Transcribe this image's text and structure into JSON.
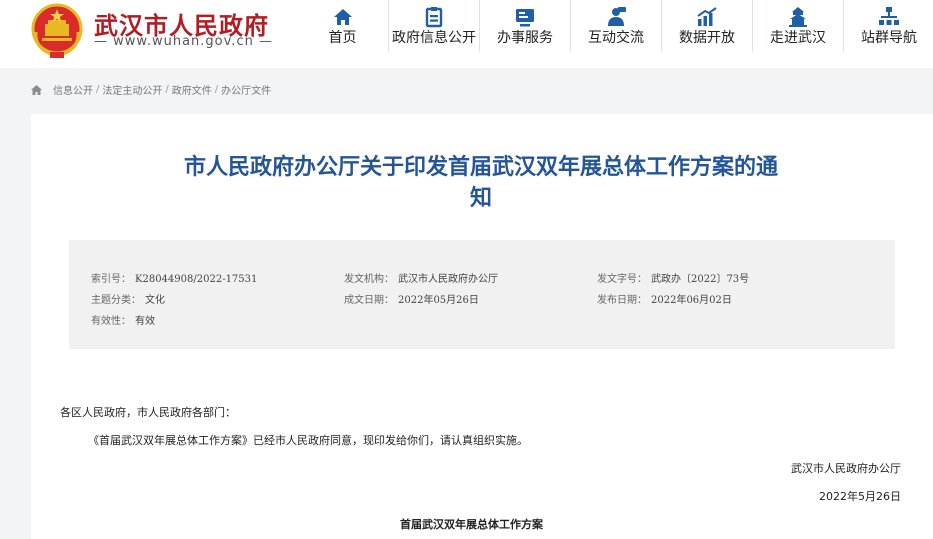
{
  "header": {
    "site_title": "武汉市人民政府",
    "site_url": "— www.wuhan.gov.cn —",
    "nav": [
      {
        "label": "首页",
        "icon": "home-icon"
      },
      {
        "label": "政府信息公开",
        "icon": "info-icon"
      },
      {
        "label": "办事服务",
        "icon": "service-icon"
      },
      {
        "label": "互动交流",
        "icon": "interaction-icon"
      },
      {
        "label": "数据开放",
        "icon": "data-chart-icon"
      },
      {
        "label": "走进武汉",
        "icon": "landmark-icon"
      },
      {
        "label": "站群导航",
        "icon": "sitemap-icon"
      }
    ]
  },
  "breadcrumb": [
    "信息公开",
    "法定主动公开",
    "政府文件",
    "办公厅文件"
  ],
  "document": {
    "title_line1": "市人民政府办公厅关于印发首届武汉双年展总体工作方案的通",
    "title_line2": "知",
    "meta": {
      "index_label": "索引号：",
      "index_value": "K28044908/2022-17531",
      "issuer_label": "发文机构：",
      "issuer_value": "武汉市人民政府办公厅",
      "doc_no_label": "发文字号：",
      "doc_no_value": "武政办〔2022〕73号",
      "category_label": "主题分类：",
      "category_value": "文化",
      "created_label": "成文日期：",
      "created_value": "2022年05月26日",
      "published_label": "发布日期：",
      "published_value": "2022年06月02日",
      "validity_label": "有效性：",
      "validity_value": "有效"
    },
    "salutation": "各区人民政府，市人民政府各部门：",
    "paragraph": "《首届武汉双年展总体工作方案》已经市人民政府同意，现印发给你们，请认真组织实施。",
    "signature": "武汉市人民政府办公厅",
    "date": "2022年5月26日",
    "attachment_title": "首届武汉双年展总体工作方案"
  },
  "colors": {
    "brand_red": "#b31c22",
    "title_blue": "#245596",
    "nav_icon_blue": "#1f5fa8"
  }
}
